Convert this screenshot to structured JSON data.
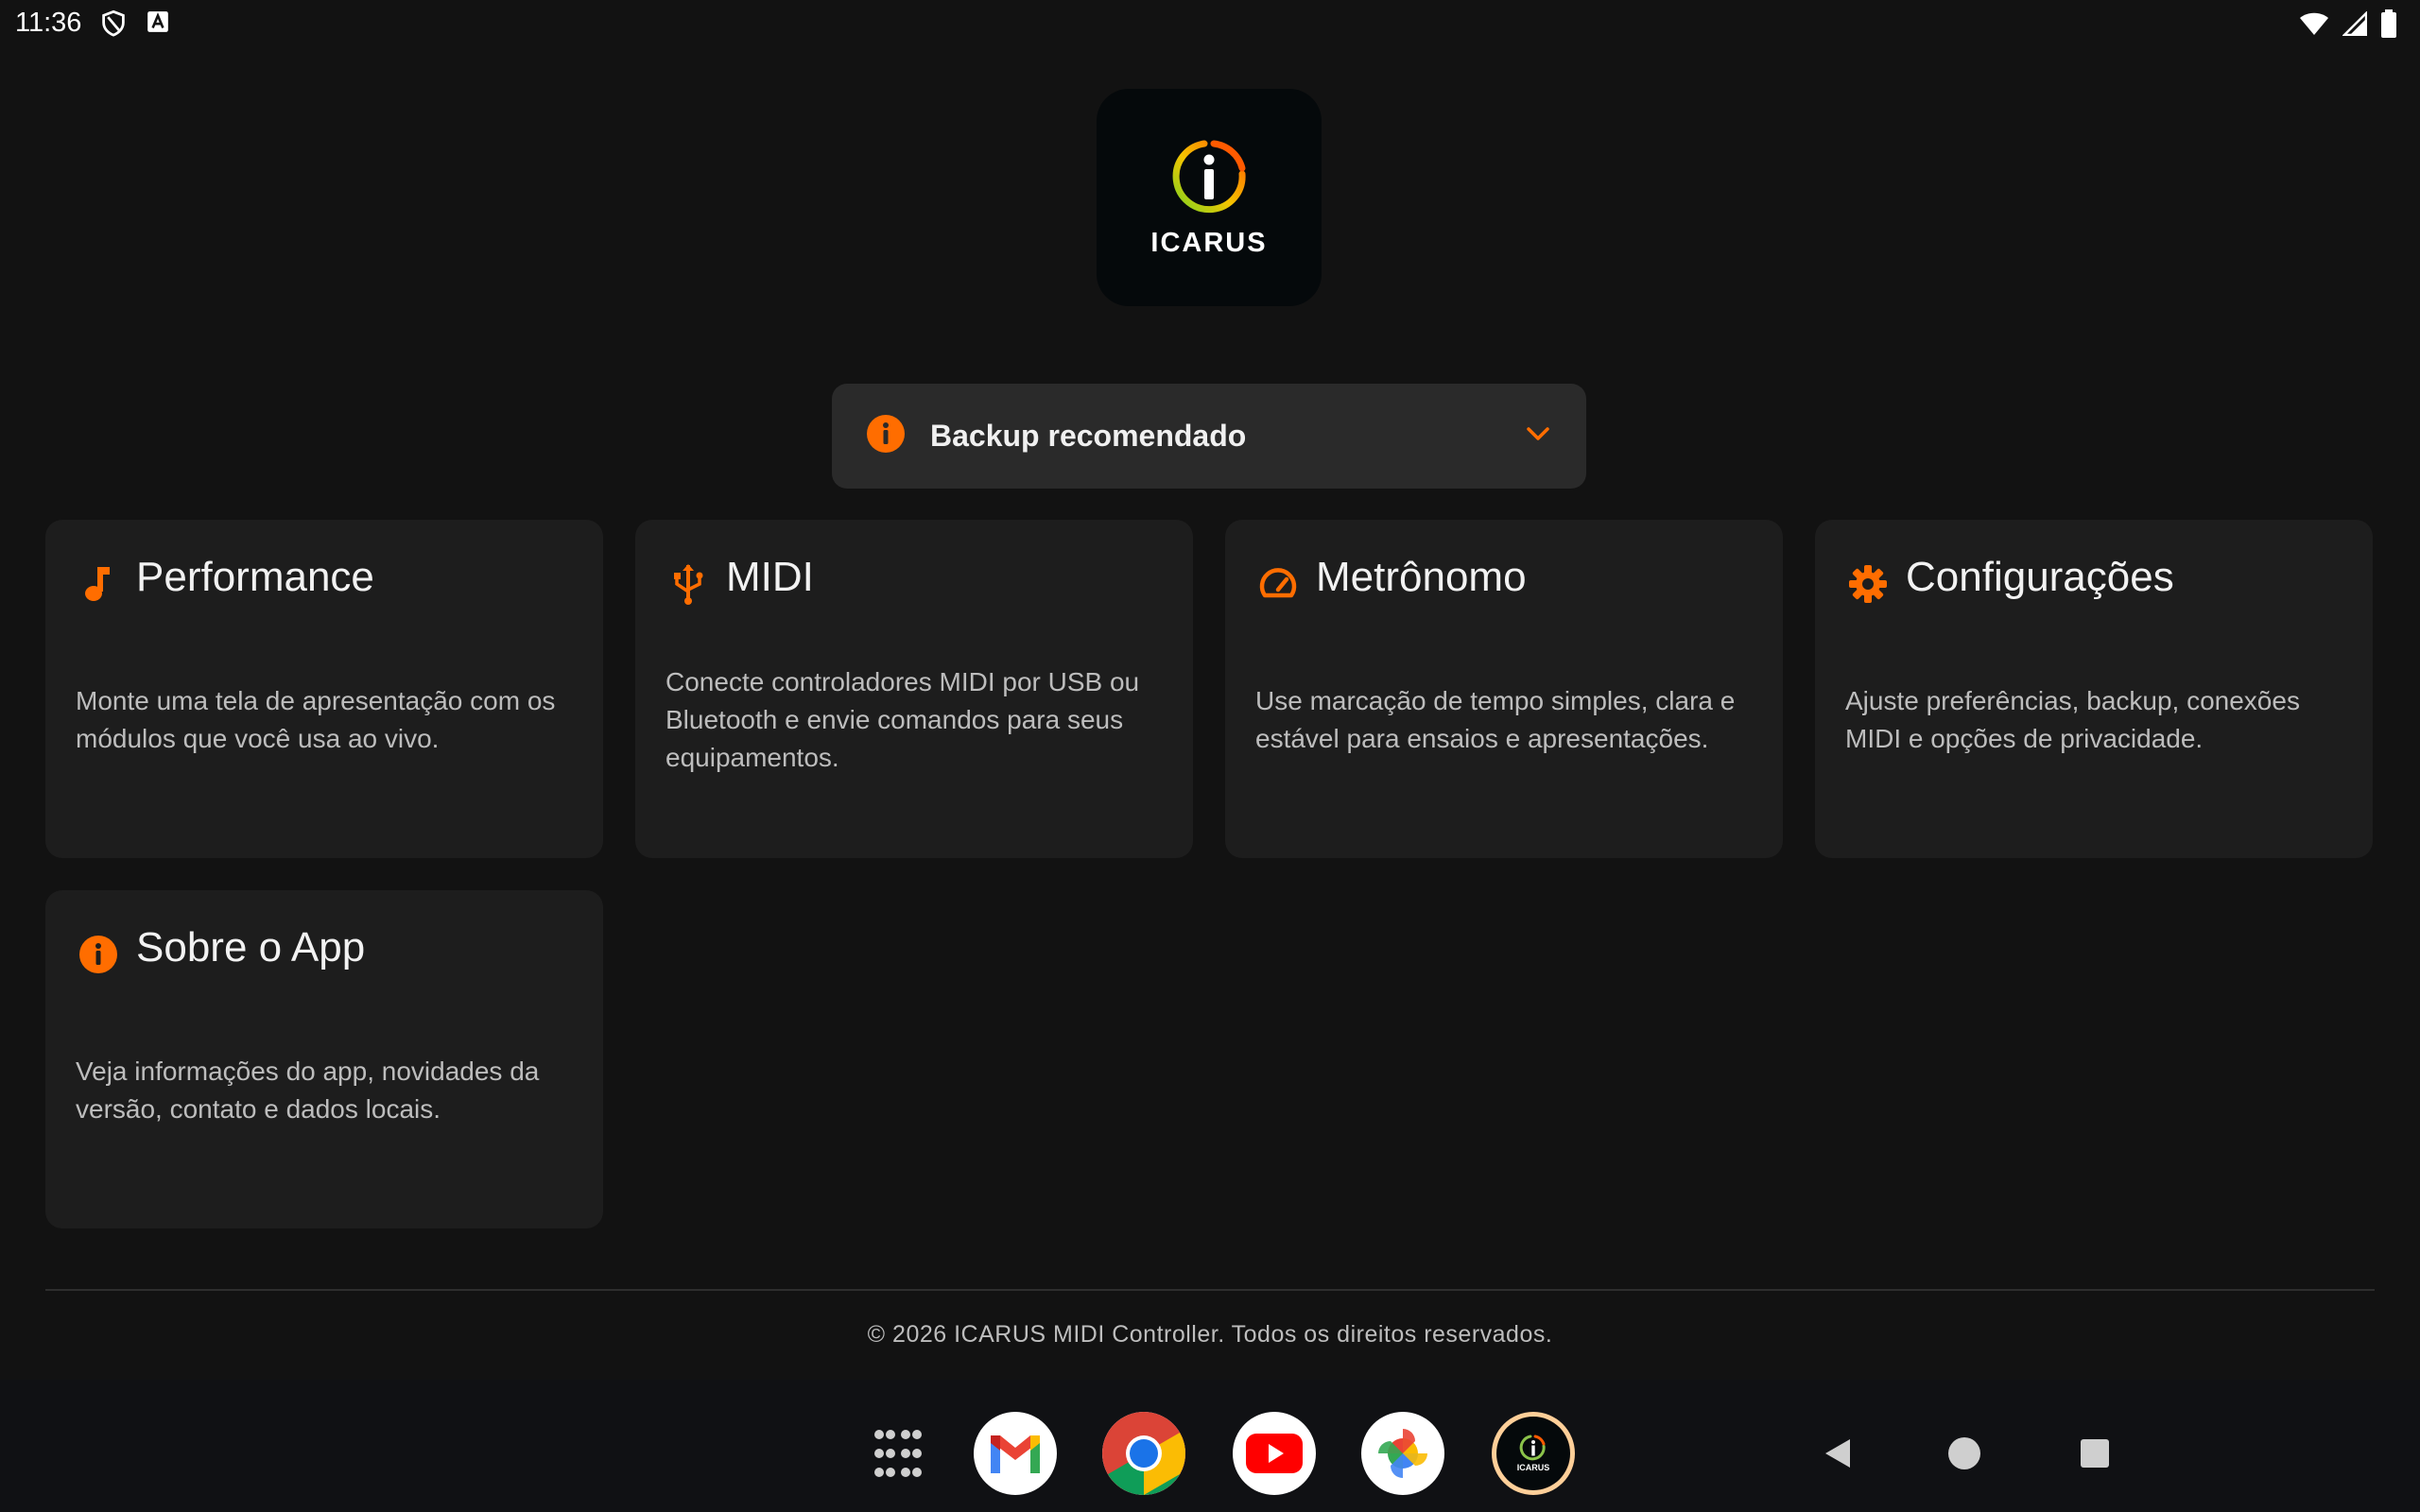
{
  "status_bar": {
    "time": "11:36"
  },
  "logo": {
    "text": "ICARUS"
  },
  "banner": {
    "text": "Backup recomendado"
  },
  "cards": [
    {
      "title": "Performance",
      "description": "Monte uma tela de apresentação com os módulos que você usa ao vivo.",
      "icon": "music-note-icon"
    },
    {
      "title": "MIDI",
      "description": "Conecte controladores MIDI por USB ou Bluetooth e envie comandos para seus equipamentos.",
      "icon": "usb-icon"
    },
    {
      "title": "Metrônomo",
      "description": "Use marcação de tempo simples, clara e estável para ensaios e apresentações.",
      "icon": "speedometer-icon"
    },
    {
      "title": "Configurações",
      "description": "Ajuste preferências, backup, conexões MIDI e opções de privacidade.",
      "icon": "gear-icon"
    },
    {
      "title": "Sobre o App",
      "description": "Veja informações do app, novidades da versão, contato e dados locais.",
      "icon": "info-icon"
    }
  ],
  "footer": {
    "copyright": "© 2026 ICARUS MIDI Controller. Todos os direitos reservados."
  },
  "dock": {
    "apps": [
      "app-drawer",
      "gmail",
      "chrome",
      "youtube",
      "photos",
      "icarus"
    ],
    "icarus_label": "ICARUS"
  },
  "colors": {
    "accent": "#ff6d00",
    "background": "#121212",
    "card": "#1d1d1d",
    "banner": "#2a2a2a"
  }
}
